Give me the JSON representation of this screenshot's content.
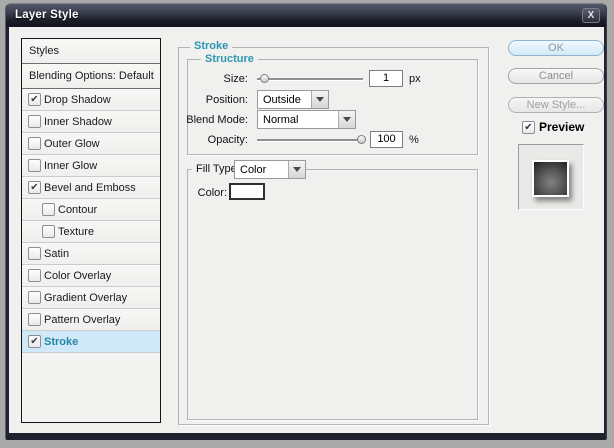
{
  "window": {
    "title": "Layer Style",
    "close_label": "X"
  },
  "sidebar": {
    "items": [
      {
        "label": "Styles",
        "type": "plain",
        "checked": null,
        "indent": false,
        "selected": false
      },
      {
        "label": "Blending Options: Default",
        "type": "plain",
        "checked": null,
        "indent": false,
        "selected": false
      },
      {
        "label": "Drop Shadow",
        "type": "check",
        "checked": true,
        "indent": false,
        "selected": false
      },
      {
        "label": "Inner Shadow",
        "type": "check",
        "checked": false,
        "indent": false,
        "selected": false
      },
      {
        "label": "Outer Glow",
        "type": "check",
        "checked": false,
        "indent": false,
        "selected": false
      },
      {
        "label": "Inner Glow",
        "type": "check",
        "checked": false,
        "indent": false,
        "selected": false
      },
      {
        "label": "Bevel and Emboss",
        "type": "check",
        "checked": true,
        "indent": false,
        "selected": false
      },
      {
        "label": "Contour",
        "type": "check",
        "checked": false,
        "indent": true,
        "selected": false
      },
      {
        "label": "Texture",
        "type": "check",
        "checked": false,
        "indent": true,
        "selected": false
      },
      {
        "label": "Satin",
        "type": "check",
        "checked": false,
        "indent": false,
        "selected": false
      },
      {
        "label": "Color Overlay",
        "type": "check",
        "checked": false,
        "indent": false,
        "selected": false
      },
      {
        "label": "Gradient Overlay",
        "type": "check",
        "checked": false,
        "indent": false,
        "selected": false
      },
      {
        "label": "Pattern Overlay",
        "type": "check",
        "checked": false,
        "indent": false,
        "selected": false
      },
      {
        "label": "Stroke",
        "type": "check",
        "checked": true,
        "indent": false,
        "selected": true
      }
    ]
  },
  "panel": {
    "legend": "Stroke",
    "structure": {
      "legend": "Structure",
      "size_label": "Size:",
      "size_value": "1",
      "size_unit": "px",
      "position_label": "Position:",
      "position_value": "Outside",
      "blend_label": "Blend Mode:",
      "blend_value": "Normal",
      "opacity_label": "Opacity:",
      "opacity_value": "100",
      "opacity_unit": "%"
    },
    "fill": {
      "legend": "Fill Type:",
      "fill_value": "Color",
      "color_label": "Color:"
    }
  },
  "actions": {
    "ok": "OK",
    "cancel": "Cancel",
    "new_style": "New Style...",
    "preview": "Preview"
  },
  "colors": {
    "accent_teal": "#2e96b0",
    "selection_bg": "#cfe9f8",
    "ok_button_bg": "#d2e9f8",
    "dialog_bg": "#f0f0ee",
    "titlebar_dark": "#1a1c26",
    "desktop_bg": "#a9a9a9"
  },
  "check_glyph": "✔"
}
